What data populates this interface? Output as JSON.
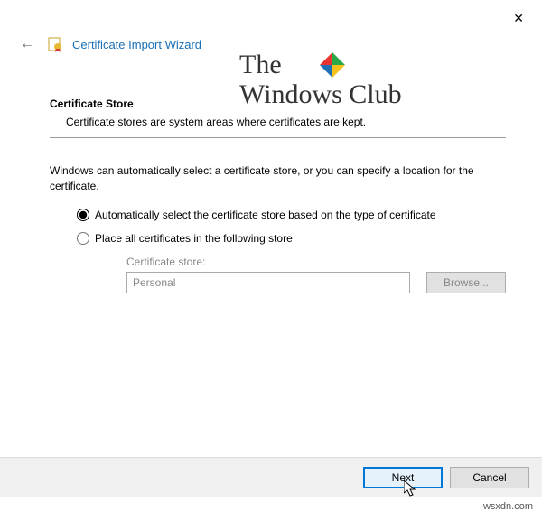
{
  "window": {
    "title": "Certificate Import Wizard"
  },
  "watermark": {
    "line1": "The",
    "line2": "Windows Club"
  },
  "section": {
    "title": "Certificate Store",
    "description": "Certificate stores are system areas where certificates are kept."
  },
  "instruction": "Windows can automatically select a certificate store, or you can specify a location for the certificate.",
  "options": {
    "auto": "Automatically select the certificate store based on the type of certificate",
    "manual": "Place all certificates in the following store"
  },
  "store": {
    "label": "Certificate store:",
    "value": "Personal",
    "browse": "Browse..."
  },
  "buttons": {
    "next": "Next",
    "cancel": "Cancel"
  },
  "attribution": "wsxdn.com"
}
